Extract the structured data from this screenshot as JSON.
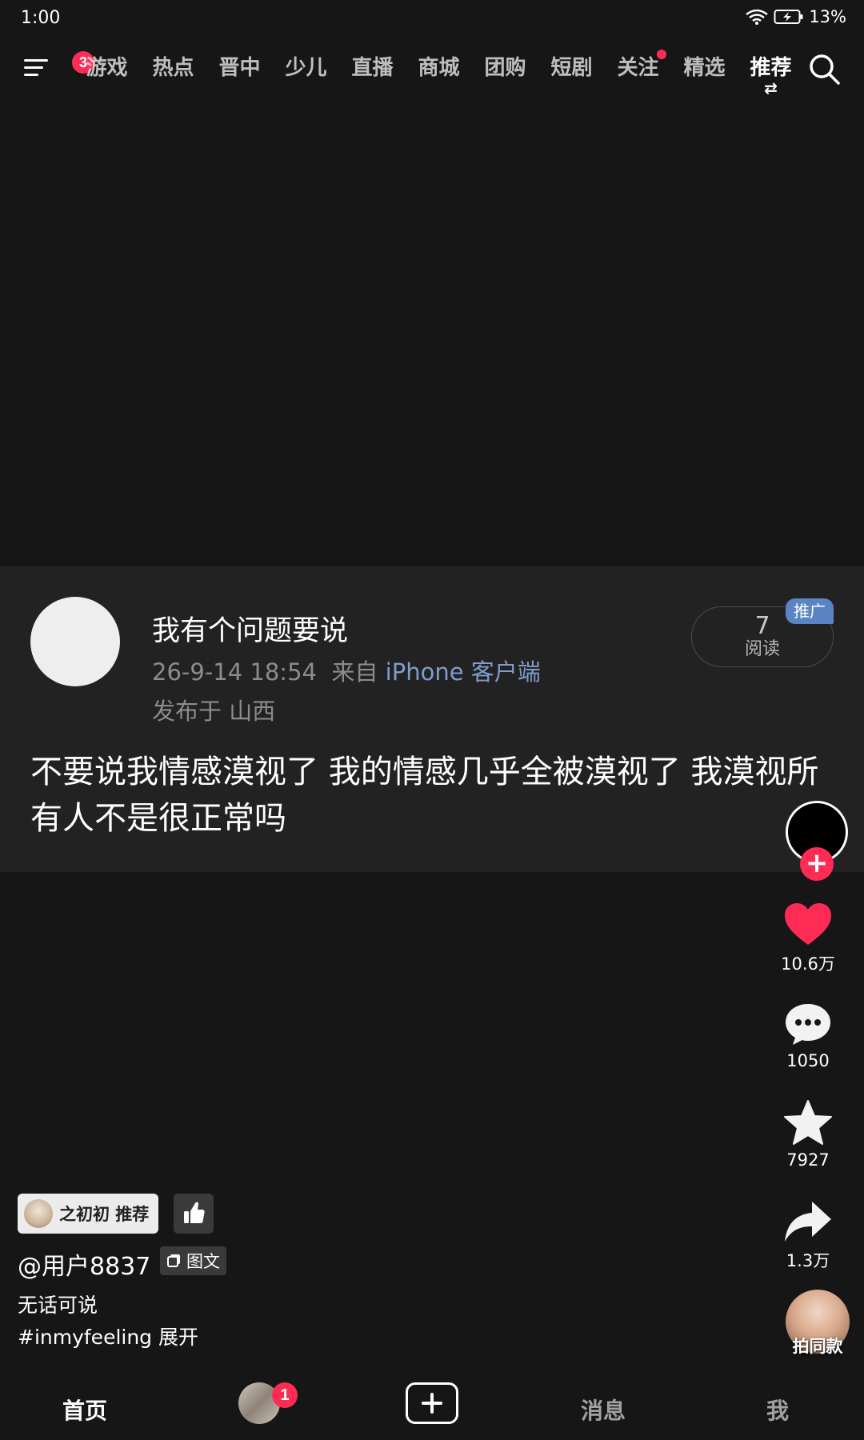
{
  "status_bar": {
    "time": "1:00",
    "battery_percent": "13%"
  },
  "top_nav": {
    "menu_badge": "3",
    "tabs": [
      {
        "label": "游戏",
        "active": false,
        "dot": false
      },
      {
        "label": "热点",
        "active": false,
        "dot": false
      },
      {
        "label": "晋中",
        "active": false,
        "dot": false
      },
      {
        "label": "少儿",
        "active": false,
        "dot": false
      },
      {
        "label": "直播",
        "active": false,
        "dot": false
      },
      {
        "label": "商城",
        "active": false,
        "dot": false
      },
      {
        "label": "团购",
        "active": false,
        "dot": false
      },
      {
        "label": "短剧",
        "active": false,
        "dot": false
      },
      {
        "label": "关注",
        "active": false,
        "dot": true
      },
      {
        "label": "精选",
        "active": false,
        "dot": false
      },
      {
        "label": "推荐",
        "active": true,
        "dot": false
      }
    ],
    "swap_symbol": "⇄"
  },
  "post": {
    "title": "我有个问题要说",
    "date": "26-9-14 18:54",
    "source_prefix": "来自",
    "source_client": "iPhone 客户端",
    "location": "发布于 山西",
    "read_count": "7",
    "read_label": "阅读",
    "promo_tag": "推广",
    "body": "不要说我情感漠视了 我的情感几乎全被漠视了 我漠视所有人不是很正常吗"
  },
  "rail": {
    "follow_symbol": "+",
    "likes": "10.6万",
    "comments": "1050",
    "favorites": "7927",
    "shares": "1.3万",
    "music_label": "拍同款"
  },
  "info": {
    "recommender": "之初初 推荐",
    "username": "@用户8837",
    "type_tag": "图文",
    "caption": "无话可说",
    "hashtag": "#inmyfeeling",
    "expand": "展开"
  },
  "tab_bar": {
    "home": "首页",
    "friend_badge": "1",
    "messages": "消息",
    "me": "我"
  },
  "colors": {
    "background": "#161616",
    "card": "#222222",
    "accent_red": "#fe2c55",
    "promo_blue": "#5b84c4",
    "client_link": "#7f9ccc"
  }
}
